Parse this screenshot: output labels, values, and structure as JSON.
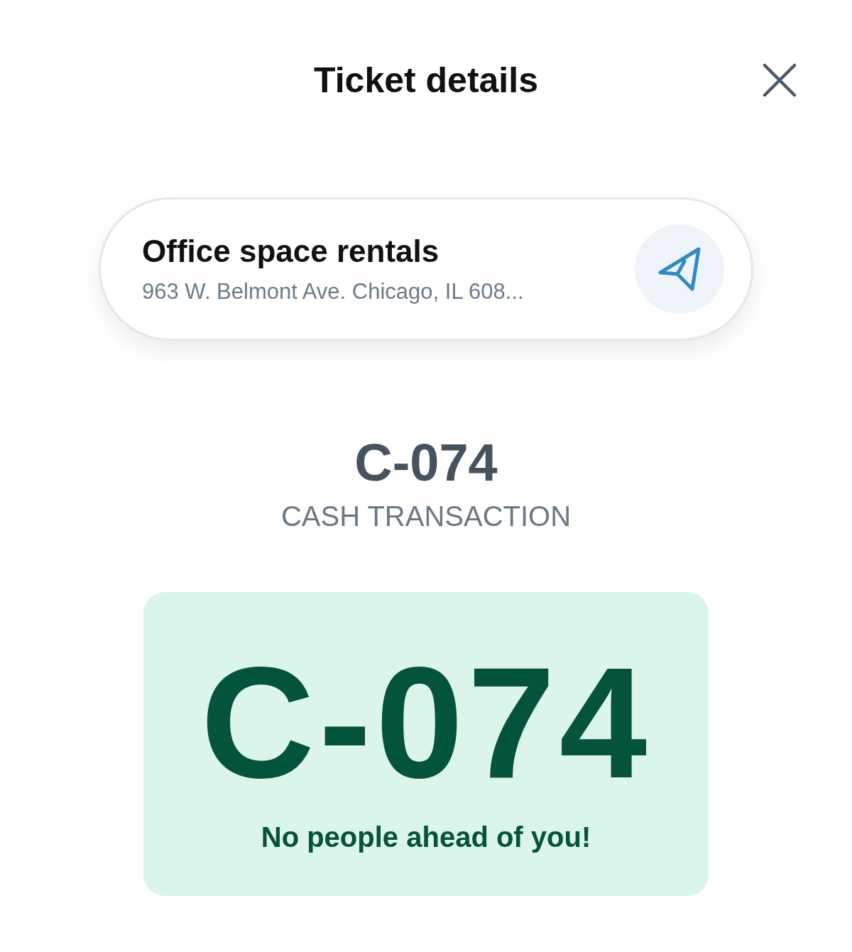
{
  "header": {
    "title": "Ticket details"
  },
  "location": {
    "name": "Office space rentals",
    "address": "963 W. Belmont Ave. Chicago, IL 608..."
  },
  "ticket": {
    "code": "C-074",
    "type": "CASH TRANSACTION"
  },
  "status_card": {
    "code": "C-074",
    "message": "No people ahead of you!"
  }
}
